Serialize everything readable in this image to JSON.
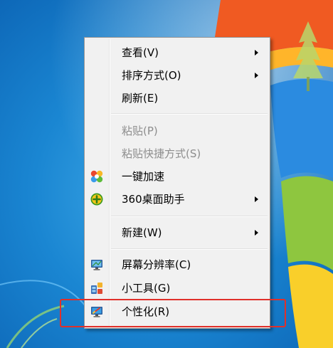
{
  "context_menu": {
    "items": [
      {
        "label": "查看(V)",
        "submenu": true,
        "disabled": false,
        "icon": ""
      },
      {
        "label": "排序方式(O)",
        "submenu": true,
        "disabled": false,
        "icon": ""
      },
      {
        "label": "刷新(E)",
        "submenu": false,
        "disabled": false,
        "icon": ""
      },
      {
        "label": "粘贴(P)",
        "submenu": false,
        "disabled": true,
        "icon": ""
      },
      {
        "label": "粘贴快捷方式(S)",
        "submenu": false,
        "disabled": true,
        "icon": ""
      },
      {
        "label": "一键加速",
        "submenu": false,
        "disabled": false,
        "icon": "speedup-icon"
      },
      {
        "label": "360桌面助手",
        "submenu": true,
        "disabled": false,
        "icon": "desktop-assistant-icon"
      },
      {
        "label": "新建(W)",
        "submenu": true,
        "disabled": false,
        "icon": ""
      },
      {
        "label": "屏幕分辨率(C)",
        "submenu": false,
        "disabled": false,
        "icon": "monitor-resolution-icon"
      },
      {
        "label": "小工具(G)",
        "submenu": false,
        "disabled": false,
        "icon": "gadgets-icon"
      },
      {
        "label": "个性化(R)",
        "submenu": false,
        "disabled": false,
        "icon": "personalize-icon",
        "highlighted": true
      }
    ]
  },
  "colors": {
    "highlight_box": "#e0302a",
    "menu_background": "#f1f1f1",
    "disabled_text": "#8d8d8d"
  }
}
